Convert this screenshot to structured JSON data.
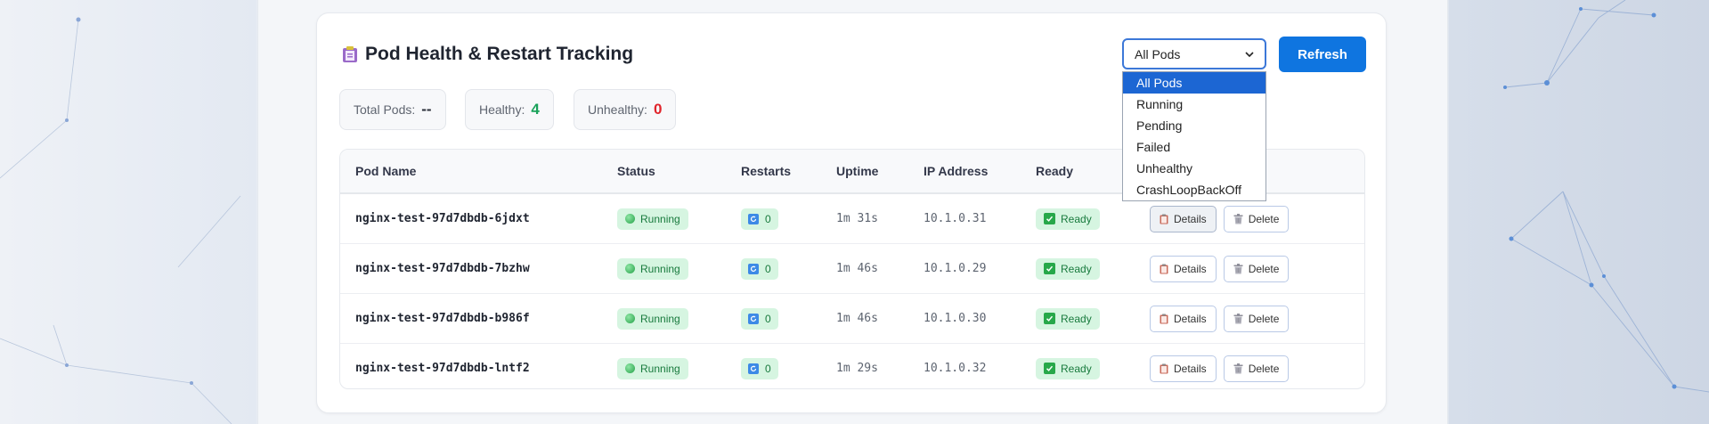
{
  "panel": {
    "title": "Pod Health & Restart Tracking",
    "title_icon": "clipboard-icon"
  },
  "filter": {
    "selected": "All Pods",
    "options": [
      "All Pods",
      "Running",
      "Pending",
      "Failed",
      "Unhealthy",
      "CrashLoopBackOff"
    ]
  },
  "refresh_label": "Refresh",
  "stats": {
    "total_label": "Total Pods:",
    "total_value": "--",
    "healthy_label": "Healthy:",
    "healthy_value": "4",
    "unhealthy_label": "Unhealthy:",
    "unhealthy_value": "0"
  },
  "colors": {
    "accent": "#0f75e0",
    "healthy": "#1aa25a",
    "unhealthy": "#e0242b"
  },
  "table": {
    "headers": {
      "name": "Pod Name",
      "status": "Status",
      "restarts": "Restarts",
      "uptime": "Uptime",
      "ip": "IP Address",
      "ready": "Ready"
    },
    "rows": [
      {
        "name": "nginx-test-97d7dbdb-6jdxt",
        "status": "Running",
        "restarts": "0",
        "uptime": "1m 31s",
        "ip": "10.1.0.31",
        "ready": "Ready",
        "details": "Details",
        "delete": "Delete"
      },
      {
        "name": "nginx-test-97d7dbdb-7bzhw",
        "status": "Running",
        "restarts": "0",
        "uptime": "1m 46s",
        "ip": "10.1.0.29",
        "ready": "Ready",
        "details": "Details",
        "delete": "Delete"
      },
      {
        "name": "nginx-test-97d7dbdb-b986f",
        "status": "Running",
        "restarts": "0",
        "uptime": "1m 46s",
        "ip": "10.1.0.30",
        "ready": "Ready",
        "details": "Details",
        "delete": "Delete"
      },
      {
        "name": "nginx-test-97d7dbdb-lntf2",
        "status": "Running",
        "restarts": "0",
        "uptime": "1m 29s",
        "ip": "10.1.0.32",
        "ready": "Ready",
        "details": "Details",
        "delete": "Delete"
      }
    ]
  }
}
